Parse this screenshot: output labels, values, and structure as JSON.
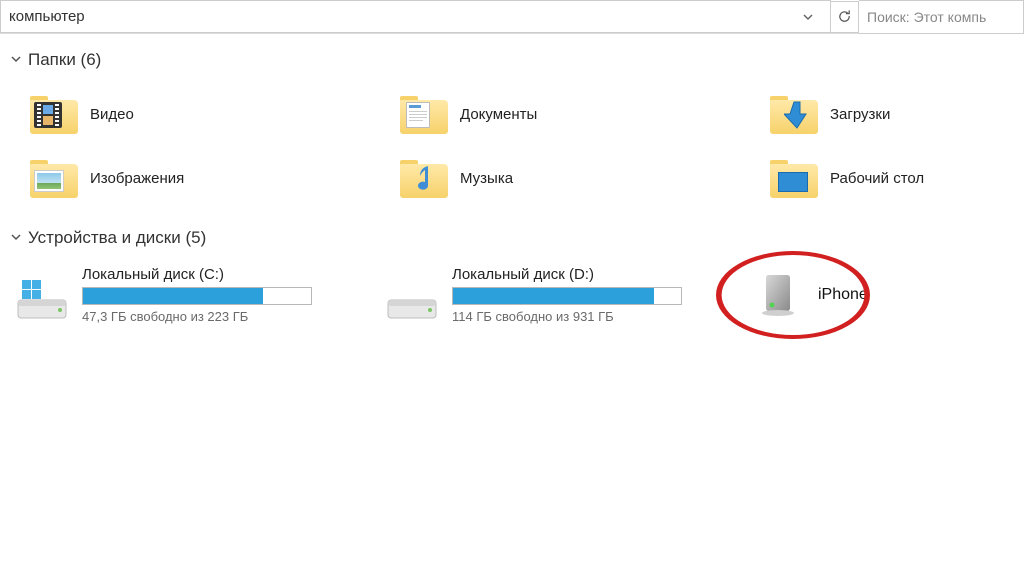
{
  "address": {
    "text": "компьютер"
  },
  "search": {
    "placeholder": "Поиск: Этот компь"
  },
  "sections": {
    "folders": {
      "title": "Папки (6)"
    },
    "drives": {
      "title": "Устройства и диски (5)"
    }
  },
  "folders": [
    {
      "label": "Видео"
    },
    {
      "label": "Документы"
    },
    {
      "label": "Загрузки"
    },
    {
      "label": "Изображения"
    },
    {
      "label": "Музыка"
    },
    {
      "label": "Рабочий стол"
    }
  ],
  "drives": [
    {
      "name": "Локальный диск (C:)",
      "free": "47,3 ГБ свободно из 223 ГБ",
      "fillPercent": 79
    },
    {
      "name": "Локальный диск (D:)",
      "free": "114 ГБ свободно из 931 ГБ",
      "fillPercent": 88
    }
  ],
  "device": {
    "label": "iPhone"
  }
}
